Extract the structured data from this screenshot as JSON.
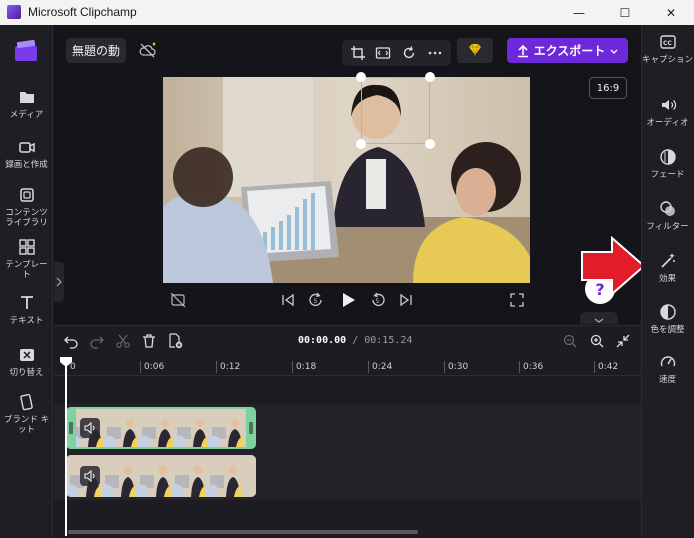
{
  "window": {
    "title": "Microsoft Clipchamp",
    "minimize": "—",
    "maximize": "☐",
    "close": "✕"
  },
  "header": {
    "project_title": "無題の動",
    "export_label": "エクスポート",
    "aspect_ratio": "16:9"
  },
  "left_rail": [
    {
      "label": "メディア",
      "icon": "folder-icon"
    },
    {
      "label": "録画と作成",
      "icon": "video-camera-icon"
    },
    {
      "label": "コンテンツ ライブラリ",
      "icon": "content-library-icon"
    },
    {
      "label": "テンプレート",
      "icon": "templates-icon"
    },
    {
      "label": "テキスト",
      "icon": "text-icon"
    },
    {
      "label": "切り替え",
      "icon": "transitions-icon"
    },
    {
      "label": "ブランド キット",
      "icon": "brand-kit-icon"
    }
  ],
  "right_rail": [
    {
      "label": "キャプション",
      "icon": "captions-icon"
    },
    {
      "label": "オーディオ",
      "icon": "audio-icon"
    },
    {
      "label": "フェード",
      "icon": "fade-icon"
    },
    {
      "label": "フィルター",
      "icon": "filter-icon"
    },
    {
      "label": "効果",
      "icon": "effects-icon"
    },
    {
      "label": "色を調整",
      "icon": "color-adjust-icon"
    },
    {
      "label": "速度",
      "icon": "speed-icon"
    }
  ],
  "timeline": {
    "current_time": "00:00.00",
    "separator": " / ",
    "total_time": "00:15.24",
    "ruler": [
      "0",
      "0:06",
      "0:12",
      "0:18",
      "0:24",
      "0:30",
      "0:36",
      "0:42"
    ]
  },
  "help_label": "?",
  "colors": {
    "accent": "#6d28d9",
    "clip_selected_border": "#7fd1a0",
    "callout_arrow": "#e11d2a",
    "crop_handles": "#7fd1a0"
  }
}
